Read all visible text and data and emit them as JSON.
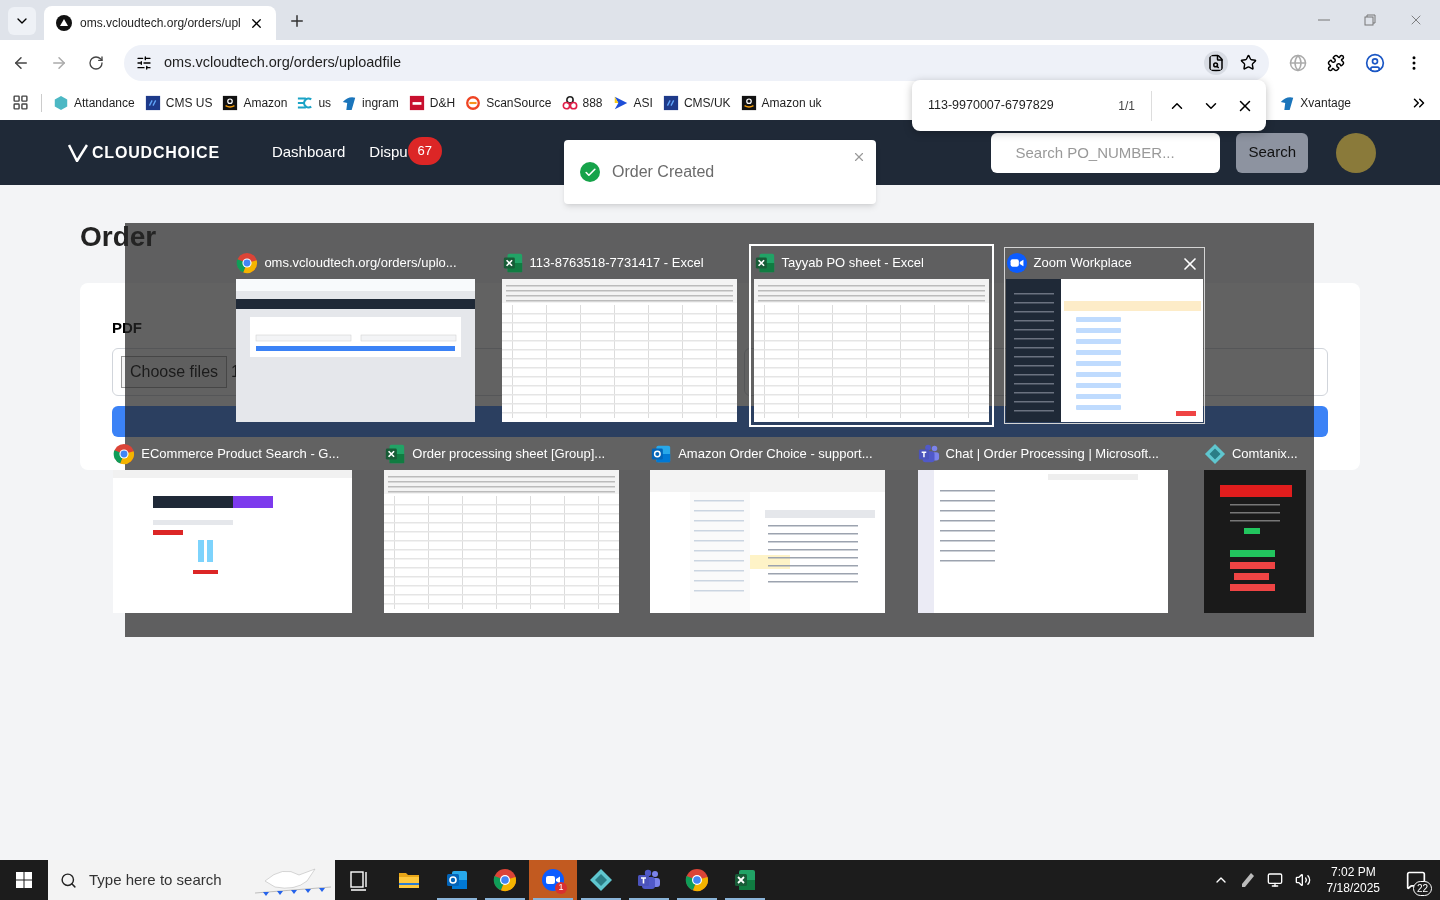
{
  "browser": {
    "tab": {
      "title": "oms.vcloudtech.org/orders/upl"
    },
    "address": "oms.vcloudtech.org/orders/uploadfile",
    "bookmarks": [
      {
        "label": "Attandance",
        "kind": "hex"
      },
      {
        "label": "CMS US",
        "kind": "df"
      },
      {
        "label": "Amazon",
        "kind": "amazon"
      },
      {
        "label": "us",
        "kind": "ec"
      },
      {
        "label": "ingram",
        "kind": "ingram"
      },
      {
        "label": "D&H",
        "kind": "dh"
      },
      {
        "label": "ScanSource",
        "kind": "scan"
      },
      {
        "label": "888",
        "kind": "rings"
      },
      {
        "label": "ASI",
        "kind": "asi"
      },
      {
        "label": "CMS/UK",
        "kind": "df"
      },
      {
        "label": "Amazon uk",
        "kind": "amazon"
      }
    ],
    "bookmarks_right": [
      {
        "label": "Xvantage",
        "kind": "ingram"
      }
    ],
    "find_bar": {
      "value": "113-9970007-6797829",
      "count": "1/1"
    }
  },
  "app": {
    "logo": "CLOUDCHOICE",
    "nav": [
      {
        "label": "Dashboard"
      },
      {
        "label": "Dispu",
        "badge": "67"
      }
    ],
    "search": {
      "placeholder": "Search PO_NUMBER...",
      "button": "Search"
    }
  },
  "toast": {
    "message": "Order Created"
  },
  "page": {
    "title": "Order",
    "pdf_label": "PDF",
    "file_button": "Choose files",
    "file_text": "1"
  },
  "switcher": {
    "rows": [
      [
        {
          "title": "oms.vcloudtech.org/orders/uplo...",
          "kind": "chrome",
          "selected": false,
          "hovered": false
        },
        {
          "title": "113-8763518-7731417 - Excel",
          "kind": "excel",
          "selected": false,
          "hovered": false
        },
        {
          "title": "Tayyab PO sheet - Excel",
          "kind": "excel",
          "selected": true,
          "hovered": false
        },
        {
          "title": "Zoom Workplace",
          "kind": "zoom",
          "selected": false,
          "hovered": true
        }
      ],
      [
        {
          "title": "ECommerce Product Search - G...",
          "kind": "chrome",
          "selected": false,
          "hovered": false
        },
        {
          "title": "Order processing sheet [Group]...",
          "kind": "excel",
          "selected": false,
          "hovered": false
        },
        {
          "title": "Amazon Order Choice - support...",
          "kind": "outlook",
          "selected": false,
          "hovered": false
        },
        {
          "title": "Chat | Order Processing | Microsoft...",
          "kind": "teams",
          "selected": false,
          "hovered": false
        },
        {
          "title": "Comtanix...",
          "kind": "comtanix",
          "selected": false,
          "hovered": false
        }
      ]
    ]
  },
  "taskbar": {
    "search_placeholder": "Type here to search",
    "apps": [
      {
        "kind": "explorer",
        "open": false,
        "flashing": false
      },
      {
        "kind": "outlook",
        "open": true,
        "flashing": false
      },
      {
        "kind": "chrome",
        "open": true,
        "flashing": false
      },
      {
        "kind": "zoom",
        "open": true,
        "flashing": true,
        "badge": "1"
      },
      {
        "kind": "comtanix",
        "open": true,
        "flashing": false
      },
      {
        "kind": "teams",
        "open": true,
        "flashing": false
      },
      {
        "kind": "chrome",
        "open": true,
        "flashing": false
      },
      {
        "kind": "excel",
        "open": true,
        "flashing": false
      }
    ],
    "time": "7:02 PM",
    "date": "7/18/2025",
    "notifications": "22"
  }
}
